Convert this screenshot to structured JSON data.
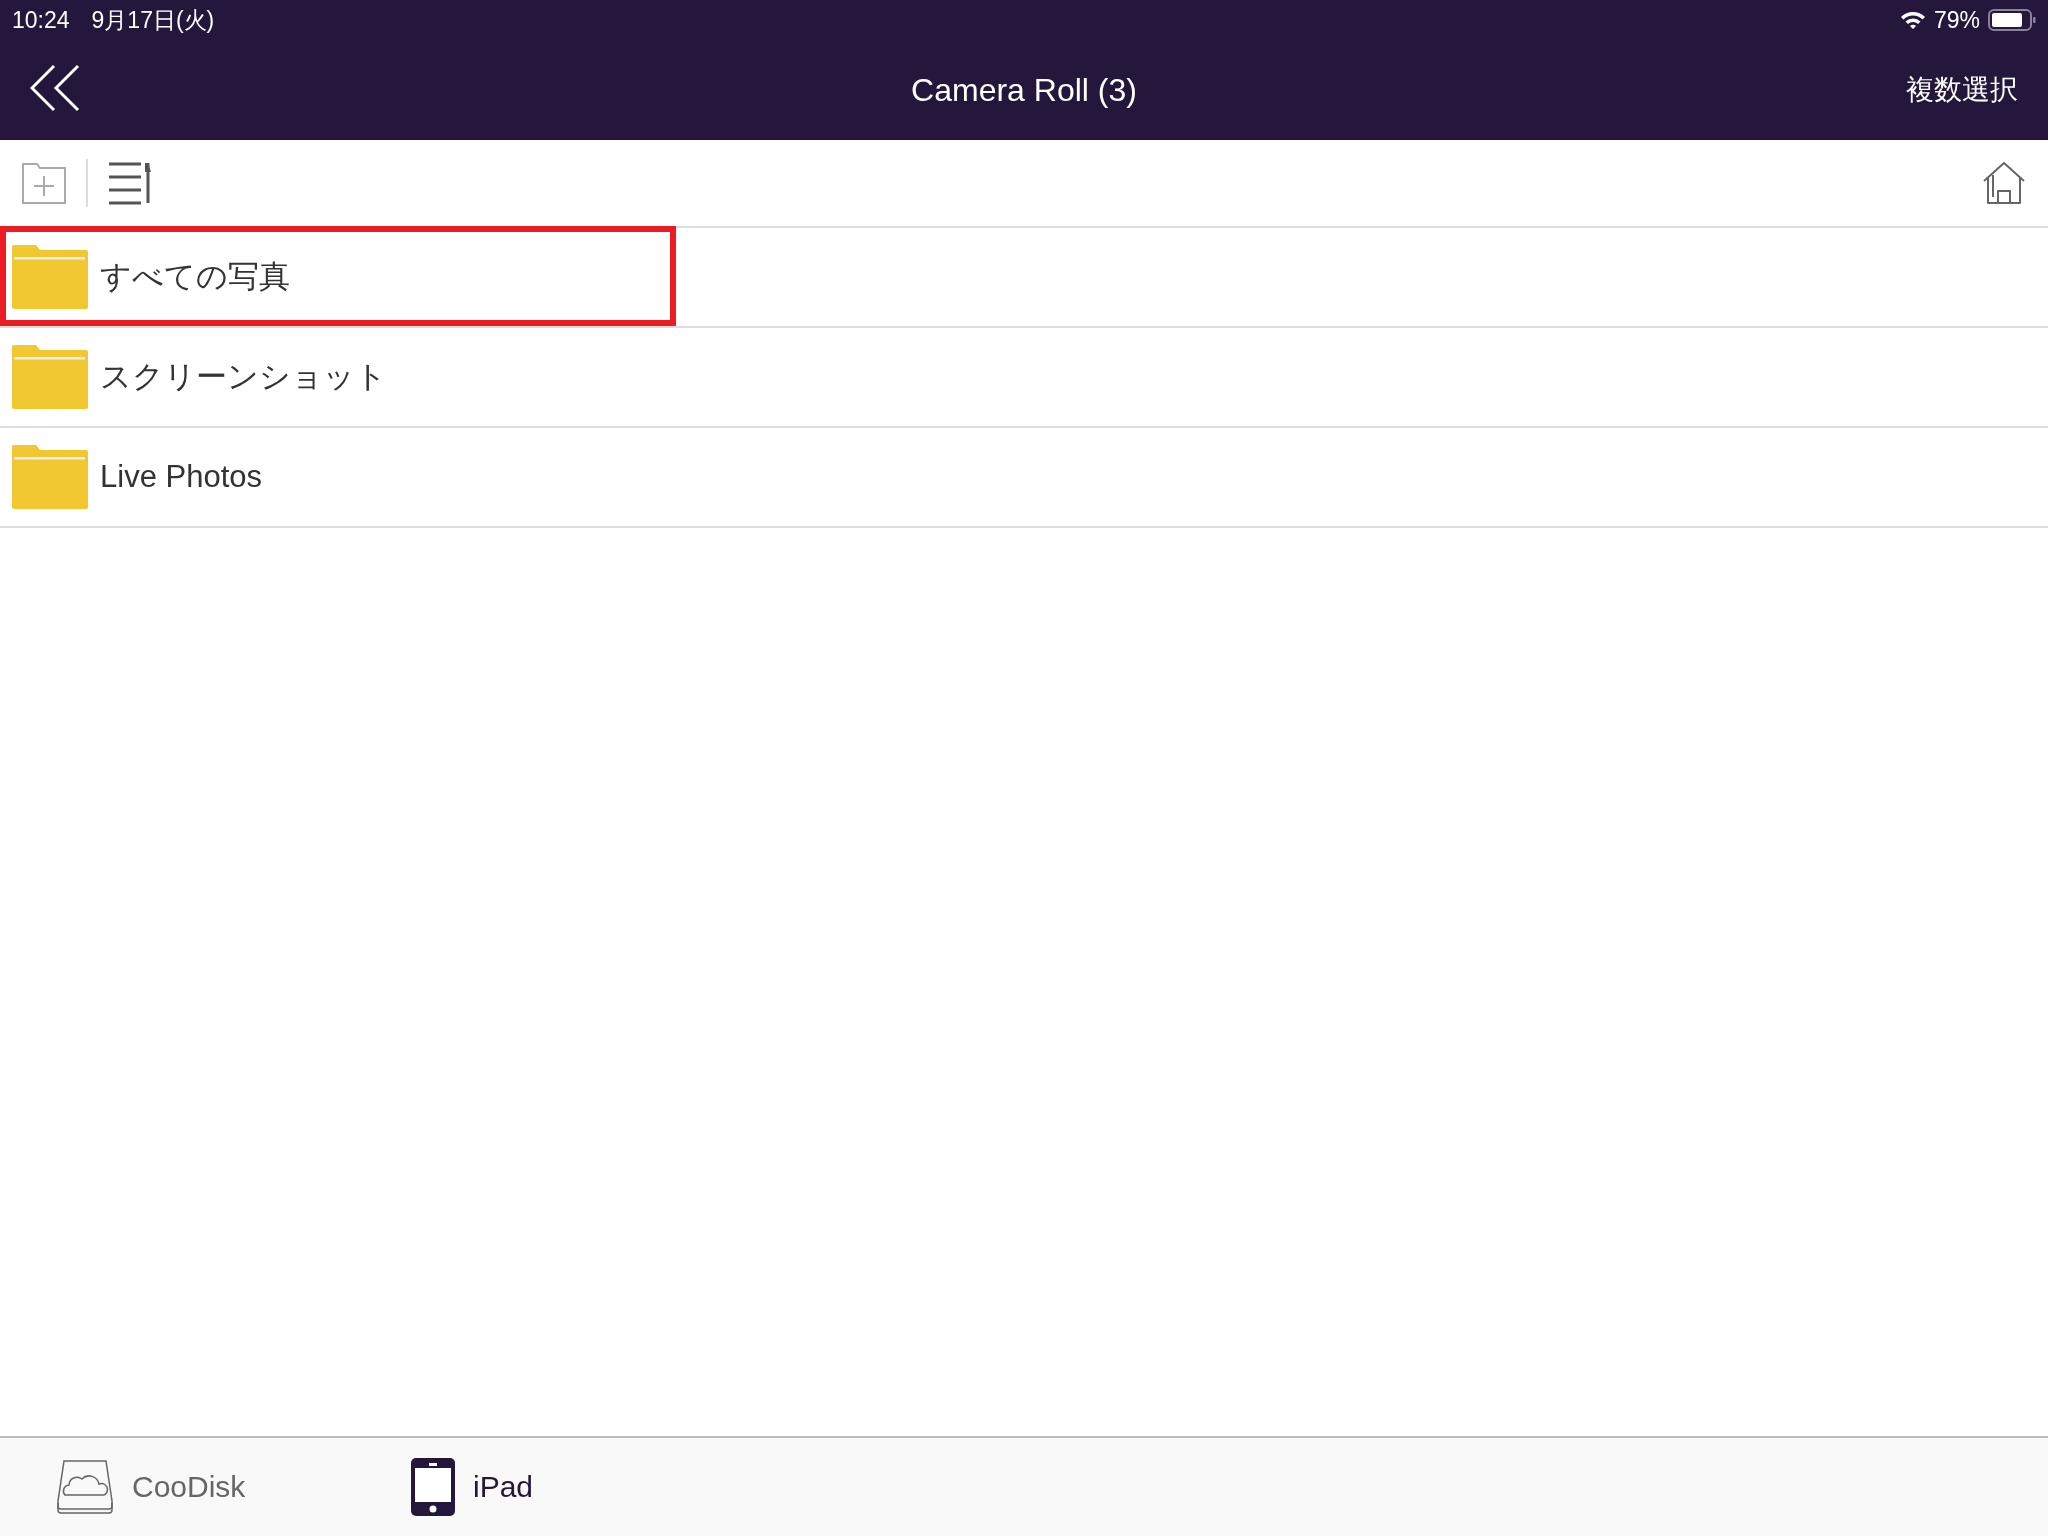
{
  "status_bar": {
    "time": "10:24",
    "date": "9月17日(火)",
    "battery": "79%"
  },
  "nav_bar": {
    "title": "Camera Roll (3)",
    "action": "複数選択"
  },
  "folders": [
    {
      "name": "すべての写真",
      "highlighted": true
    },
    {
      "name": "スクリーンショット",
      "highlighted": false
    },
    {
      "name": "Live Photos",
      "highlighted": false
    }
  ],
  "tabs": [
    {
      "label": "CooDisk",
      "kind": "cloud",
      "selected": false
    },
    {
      "label": "iPad",
      "kind": "device",
      "selected": true
    }
  ]
}
